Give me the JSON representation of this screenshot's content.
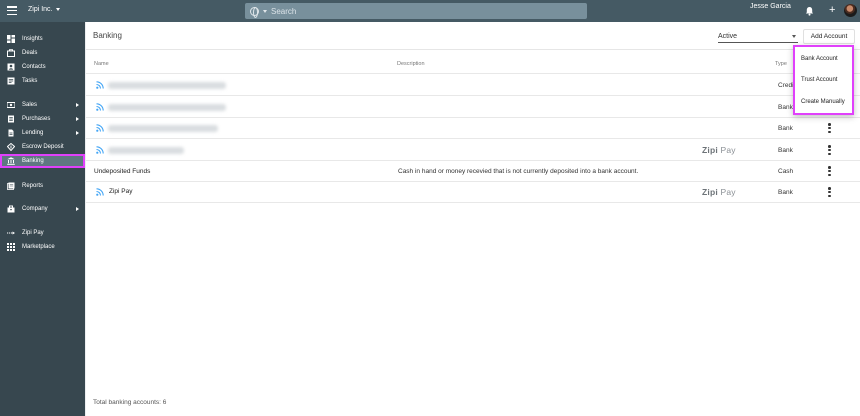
{
  "topbar": {
    "company": "Zipi Inc.",
    "search_placeholder": "Search",
    "user_name": "Jesse Garcia",
    "plus_symbol": "+"
  },
  "sidebar": {
    "items": [
      {
        "label": "Insights",
        "icon": "insights-icon"
      },
      {
        "label": "Deals",
        "icon": "deals-icon"
      },
      {
        "label": "Contacts",
        "icon": "contacts-icon"
      },
      {
        "label": "Tasks",
        "icon": "tasks-icon"
      },
      {
        "label": "Sales",
        "icon": "sales-icon"
      },
      {
        "label": "Purchases",
        "icon": "purchases-icon"
      },
      {
        "label": "Lending",
        "icon": "lending-icon"
      },
      {
        "label": "Escrow Deposit",
        "icon": "escrow-icon"
      },
      {
        "label": "Banking",
        "icon": "bank-icon",
        "active": true
      },
      {
        "label": "Reports",
        "icon": "reports-icon"
      },
      {
        "label": "Company",
        "icon": "company-icon"
      },
      {
        "label": "Zipi Pay",
        "icon": "zipi-pay-icon"
      },
      {
        "label": "Marketplace",
        "icon": "marketplace-icon"
      }
    ]
  },
  "main": {
    "title": "Banking",
    "status_filter": "Active",
    "add_account_label": "Add Account",
    "columns": {
      "name": "Name",
      "description": "Description",
      "type": "Type"
    },
    "rows": [
      {
        "name": "",
        "description": "",
        "zipi_pay": false,
        "type": "Credit",
        "obscured": true
      },
      {
        "name": "",
        "description": "",
        "zipi_pay": false,
        "type": "Bank",
        "obscured": true
      },
      {
        "name": "",
        "description": "",
        "zipi_pay": false,
        "type": "Bank",
        "obscured": true
      },
      {
        "name": "",
        "description": "",
        "zipi_pay": true,
        "type": "Bank",
        "obscured": true
      },
      {
        "name": "Undeposited Funds",
        "description": "Cash in hand or money recevied that is not currently deposited into a bank account.",
        "zipi_pay": false,
        "type": "Cash",
        "obscured": false
      },
      {
        "name": "Zipi Pay",
        "description": "",
        "zipi_pay": true,
        "type": "Bank",
        "obscured": false
      }
    ],
    "zipi_logo": {
      "brand": "Zipi",
      "suffix": "Pay"
    },
    "total": "Total banking accounts: 6"
  },
  "add_account_menu": {
    "items": [
      "Bank Account",
      "Trust Account",
      "Create Manually"
    ]
  },
  "colors": {
    "topbar": "#455a64",
    "sidebar": "#37474f",
    "highlight": "#e040fb"
  }
}
